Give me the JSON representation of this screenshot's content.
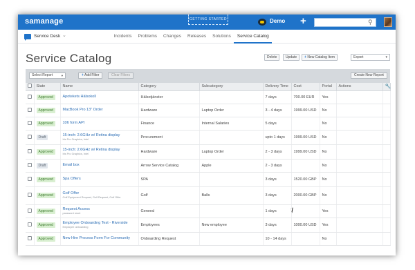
{
  "topbar": {
    "logo": "samanage",
    "getting_started": "GETTING STARTED",
    "account_name": "Demo",
    "plus_label": "+",
    "search_placeholder": ""
  },
  "subnav": {
    "service_desk": "Service Desk",
    "tabs": [
      {
        "label": "Incidents",
        "active": false
      },
      {
        "label": "Problems",
        "active": false
      },
      {
        "label": "Changes",
        "active": false
      },
      {
        "label": "Releases",
        "active": false
      },
      {
        "label": "Solutions",
        "active": false
      },
      {
        "label": "Service Catalog",
        "active": true
      }
    ]
  },
  "header": {
    "title": "Service Catalog",
    "delete_label": "Delete",
    "update_label": "Update",
    "new_item_label": "New Catalog Item",
    "export_label": "Export"
  },
  "filterbar": {
    "select_report": "Select Report",
    "add_filter": "Add Filter",
    "clear_filters": "Clear Filters",
    "create_report": "Create New Report"
  },
  "table": {
    "columns": [
      "State",
      "Name",
      "Category",
      "Subcategory",
      "Delivery Time",
      "Cost",
      "Portal",
      "Actions"
    ],
    "rows": [
      {
        "state": "Approved",
        "name": "Apotekets Hälsokoll",
        "sub": "",
        "category": "Hälsotjänster",
        "subcategory": "",
        "delivery": "7 days",
        "cost": "700.00 EUR",
        "portal": "Yes"
      },
      {
        "state": "Approved",
        "name": "MacBook Pro 13\" Order",
        "sub": "",
        "category": "Hardware",
        "subcategory": "Laptop Order",
        "delivery": "3 - 4 days",
        "cost": "1999.00 USD",
        "portal": "No"
      },
      {
        "state": "Approved",
        "name": "106 form API",
        "sub": "",
        "category": "Finance",
        "subcategory": "Internal Salaries",
        "delivery": "5 days",
        "cost": "",
        "portal": "No"
      },
      {
        "state": "Draft",
        "name": "15-inch: 2.6GHz w/ Retina display",
        "sub": "Iris Pro Graphics, Intel",
        "category": "Procurement",
        "subcategory": "",
        "delivery": "upto 1 days",
        "cost": "1999.00 USD",
        "portal": "No"
      },
      {
        "state": "Approved",
        "name": "15-inch: 2.6GHz w/ Retina display",
        "sub": "Iris Pro Graphics, Intel",
        "category": "Hardware",
        "subcategory": "Laptop Order",
        "delivery": "2 - 3 days",
        "cost": "1999.00 USD",
        "portal": "No"
      },
      {
        "state": "Draft",
        "name": "Email box",
        "sub": "",
        "category": "Arrow Service Catalog",
        "subcategory": "Apple",
        "delivery": "2 - 3 days",
        "cost": "",
        "portal": "No"
      },
      {
        "state": "Approved",
        "name": "Spa Offers",
        "sub": "",
        "category": "SPA",
        "subcategory": "",
        "delivery": "3 days",
        "cost": "1520.00 GBP",
        "portal": "No"
      },
      {
        "state": "Approved",
        "name": "Golf Offer",
        "sub": "Golf Equipment Request, Golf Request, Golf Offer",
        "category": "Golf",
        "subcategory": "Balls",
        "delivery": "3 days",
        "cost": "2000.00 GBP",
        "portal": "No"
      },
      {
        "state": "Approved",
        "name": "Request Access",
        "sub": "password reset",
        "category": "General",
        "subcategory": "",
        "delivery": "1 days",
        "cost": "",
        "portal": "Yes"
      },
      {
        "state": "Approved",
        "name": "Employee Onboarding Test - Riverside",
        "sub": "Employee onboarding",
        "category": "Employees",
        "subcategory": "New employee",
        "delivery": "3 days",
        "cost": "1000.00 USD",
        "portal": "Yes"
      },
      {
        "state": "Approved",
        "name": "New Hire Process Form For Community",
        "sub": "",
        "category": "Onboarding Request",
        "subcategory": "",
        "delivery": "10 - 14 days",
        "cost": "",
        "portal": "No"
      }
    ]
  },
  "colors": {
    "brand": "#1f73c9",
    "approved_bg": "#d9efd1",
    "draft_bg": "#e1e6ec"
  }
}
